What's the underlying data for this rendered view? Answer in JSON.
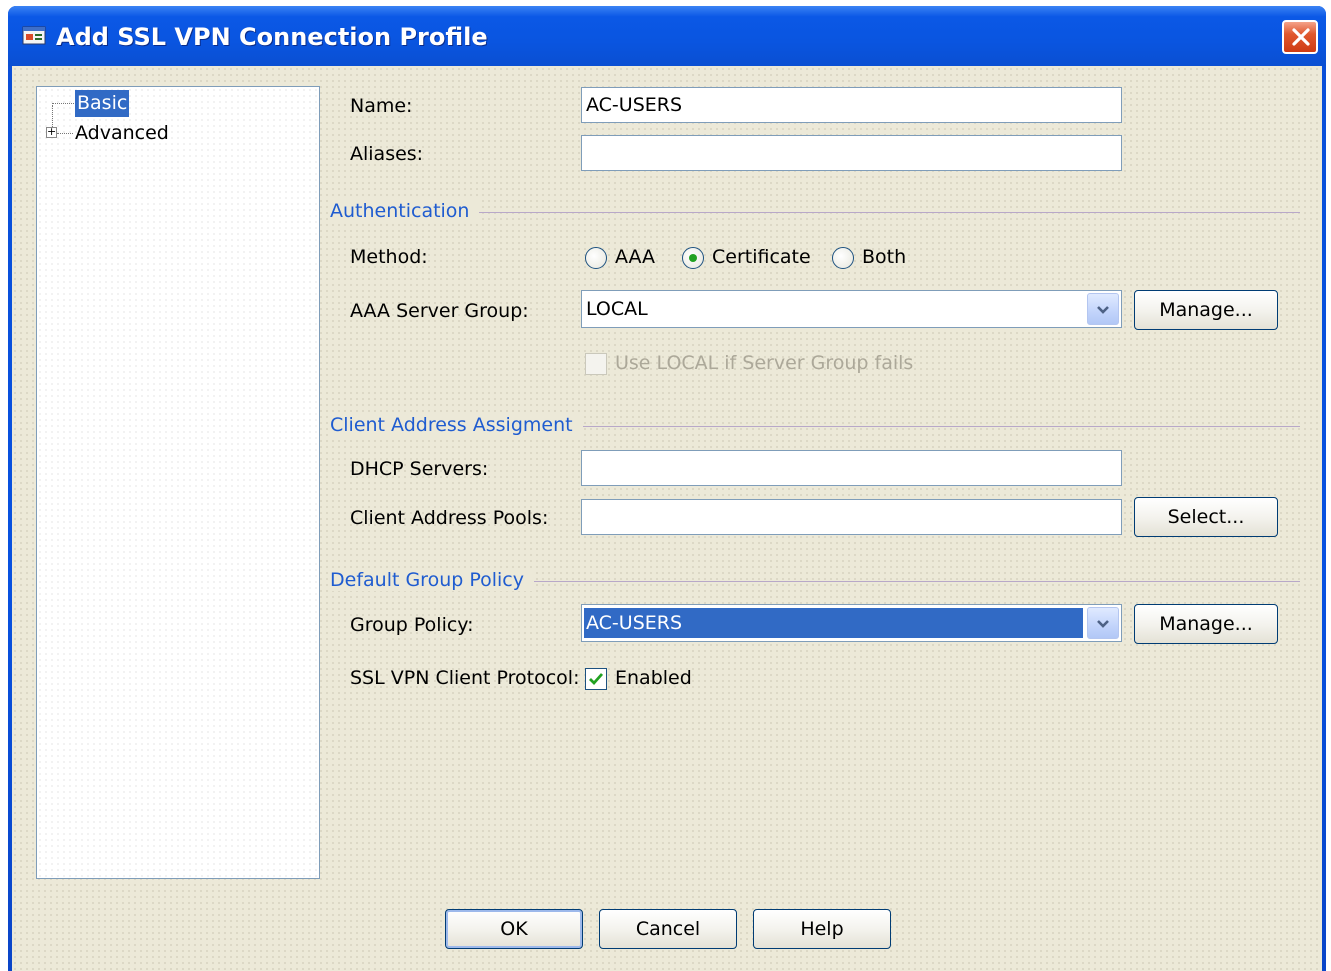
{
  "window": {
    "title": "Add SSL VPN Connection Profile"
  },
  "tree": {
    "items": [
      {
        "label": "Basic",
        "selected": true
      },
      {
        "label": "Advanced",
        "expandable": true
      }
    ]
  },
  "form": {
    "name": {
      "label": "Name:",
      "value": "AC-USERS"
    },
    "aliases": {
      "label": "Aliases:",
      "value": ""
    },
    "authentication": {
      "section_title": "Authentication",
      "method_label": "Method:",
      "methods": [
        {
          "label": "AAA",
          "checked": false
        },
        {
          "label": "Certificate",
          "checked": true
        },
        {
          "label": "Both",
          "checked": false
        }
      ],
      "aaa_server_group_label": "AAA Server Group:",
      "aaa_server_group_value": "LOCAL",
      "manage_label": "Manage...",
      "use_local_label": "Use LOCAL if Server Group fails",
      "use_local_checked": false,
      "use_local_enabled": false
    },
    "client_address": {
      "section_title": "Client Address Assigment",
      "dhcp_label": "DHCP Servers:",
      "dhcp_value": "",
      "pools_label": "Client Address Pools:",
      "pools_value": "",
      "select_label": "Select..."
    },
    "group_policy": {
      "section_title": "Default Group Policy",
      "label": "Group Policy:",
      "value": "AC-USERS",
      "manage_label": "Manage...",
      "protocol_label": "SSL VPN Client Protocol:",
      "enabled_label": "Enabled",
      "enabled_checked": true
    }
  },
  "footer": {
    "ok_label": "OK",
    "cancel_label": "Cancel",
    "help_label": "Help"
  },
  "colors": {
    "title_blue": "#0a55e0",
    "section_blue": "#1f5cd0",
    "selection": "#316ac5",
    "dialog_bg": "#ece9d8",
    "close_red": "#e0582e"
  },
  "icons": {
    "title_icon": "vpn-profile-icon",
    "close_icon": "close-icon",
    "dropdown_icon": "chevron-down-icon",
    "check_icon": "check-icon"
  }
}
